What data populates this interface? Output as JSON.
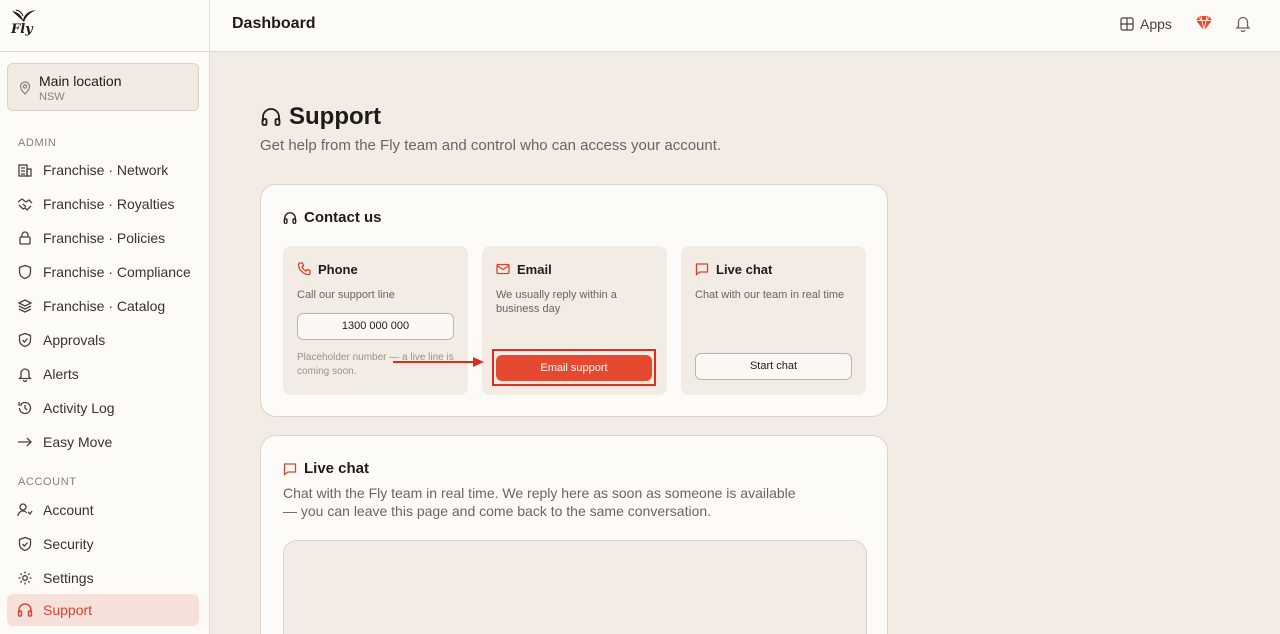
{
  "brand": {
    "logo_text": "Fly",
    "accent": "#e5492f"
  },
  "header": {
    "title": "Dashboard",
    "apps_label": "Apps",
    "icons": [
      "grid-icon",
      "gem-icon",
      "bell-icon"
    ]
  },
  "location": {
    "name": "Main location",
    "state": "NSW",
    "icon": "map-pin-icon"
  },
  "sidebar": {
    "admin_label": "ADMIN",
    "admin_items": [
      {
        "label": "Franchise · Network",
        "icon": "building-icon"
      },
      {
        "label": "Franchise · Royalties",
        "icon": "handshake-icon"
      },
      {
        "label": "Franchise · Policies",
        "icon": "lock-icon"
      },
      {
        "label": "Franchise · Compliance",
        "icon": "shield-icon"
      },
      {
        "label": "Franchise · Catalog",
        "icon": "layers-icon"
      },
      {
        "label": "Approvals",
        "icon": "shield-check-icon"
      },
      {
        "label": "Alerts",
        "icon": "bell-icon"
      },
      {
        "label": "Activity Log",
        "icon": "history-icon"
      },
      {
        "label": "Easy Move",
        "icon": "arrow-right-icon"
      }
    ],
    "account_label": "ACCOUNT",
    "account_items": [
      {
        "label": "Account",
        "icon": "user-icon"
      },
      {
        "label": "Security",
        "icon": "shield-icon"
      },
      {
        "label": "Settings",
        "icon": "gear-icon"
      },
      {
        "label": "Support",
        "icon": "headphones-icon",
        "active": true
      }
    ]
  },
  "page": {
    "title": "Support",
    "subtitle": "Get help from the Fly team and control who can access your account."
  },
  "contact": {
    "title": "Contact us",
    "phone": {
      "title": "Phone",
      "desc": "Call our support line",
      "number": "1300 000 000",
      "note": "Placeholder number — a live line is coming soon."
    },
    "email": {
      "title": "Email",
      "desc": "We usually reply within a business day",
      "button": "Email support"
    },
    "chat": {
      "title": "Live chat",
      "desc": "Chat with our team in real time",
      "button": "Start chat"
    }
  },
  "live_chat": {
    "title": "Live chat",
    "desc": "Chat with the Fly team in real time. We reply here as soon as someone is available — you can leave this page and come back to the same conversation."
  }
}
